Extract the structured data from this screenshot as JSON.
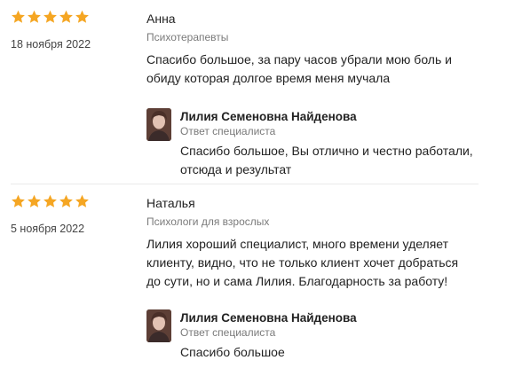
{
  "colors": {
    "star": "#f5a623",
    "muted": "#7a7a7a",
    "text": "#222222",
    "divider": "#e9e9e9"
  },
  "reviews": [
    {
      "rating": 5,
      "date": "18 ноября 2022",
      "author": "Анна",
      "category": "Психотерапевты",
      "text": "Спасибо большое, за пару часов убрали мою боль и обиду которая долгое время меня мучала",
      "answer": {
        "avatar_icon": "specialist-avatar",
        "name": "Лилия Семеновна Найденова",
        "role": "Ответ специалиста",
        "text": "Спасибо большое, Вы отлично и честно работали, отсюда и результат"
      }
    },
    {
      "rating": 5,
      "date": "5 ноября 2022",
      "author": "Наталья",
      "category": "Психологи для взрослых",
      "text": "Лилия хороший специалист, много времени уделяет клиенту, видно, что не только клиент хочет добраться до сути, но и сама Лилия. Благодарность за работу!",
      "answer": {
        "avatar_icon": "specialist-avatar",
        "name": "Лилия Семеновна Найденова",
        "role": "Ответ специалиста",
        "text": "Спасибо большое"
      }
    }
  ]
}
